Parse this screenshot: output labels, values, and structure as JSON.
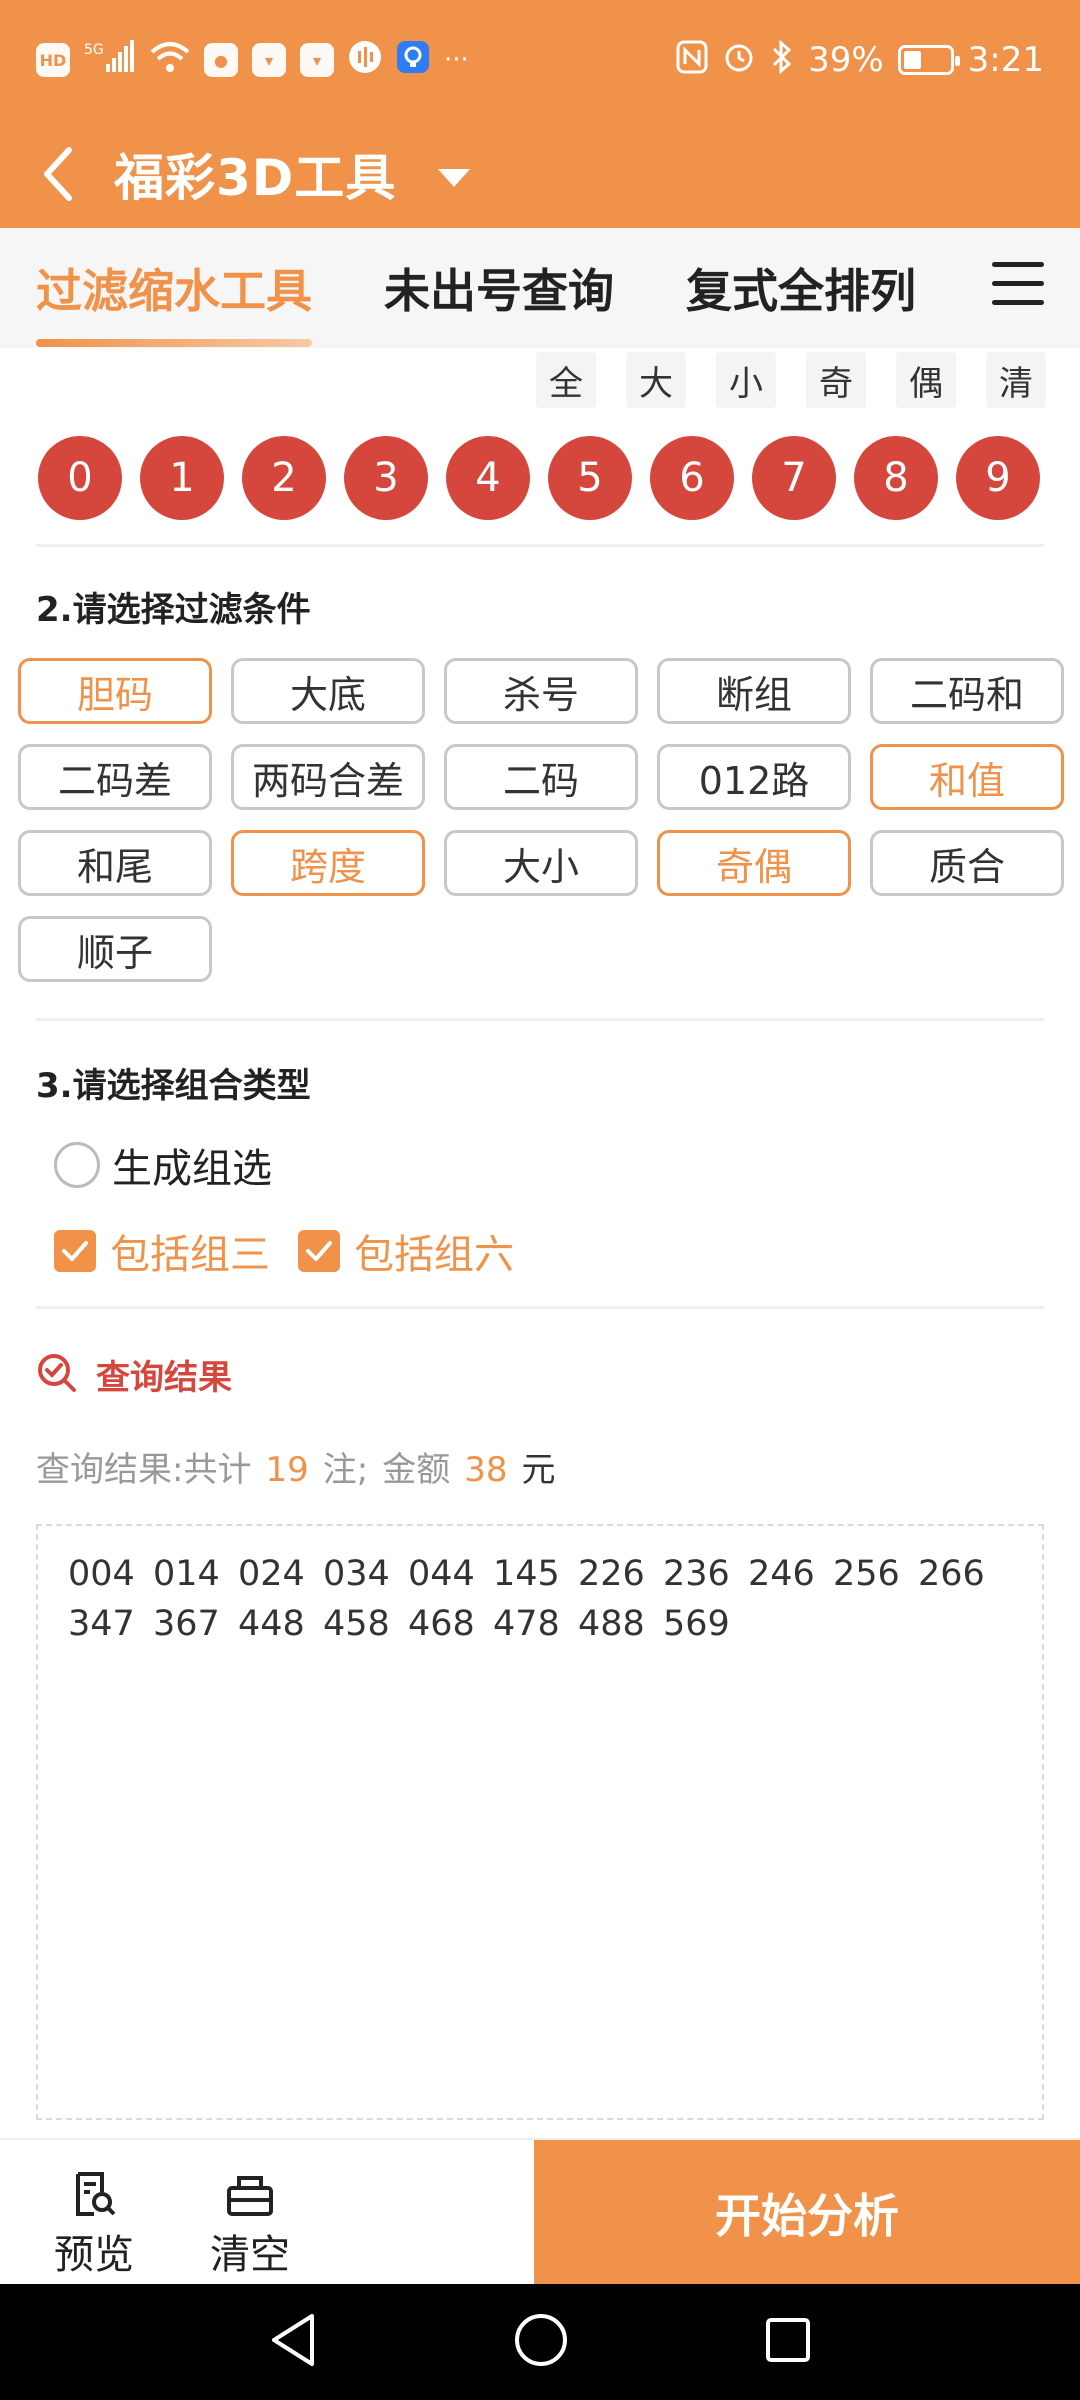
{
  "status_bar": {
    "left_icons": [
      "hd-icon",
      "signal-5g-icon",
      "wifi-icon",
      "weibo-icon",
      "bag-icon",
      "bag-icon",
      "voice-icon",
      "bulb-icon",
      "more-icon"
    ],
    "hd": "HD",
    "network": "5G",
    "more": "···",
    "battery_percent": "39%",
    "battery_level": 0.39,
    "time": "3:21"
  },
  "header": {
    "title": "福彩3D工具"
  },
  "tabs": [
    {
      "label": "过滤缩水工具",
      "active": true
    },
    {
      "label": "未出号查询",
      "active": false
    },
    {
      "label": "复式全排列",
      "active": false
    }
  ],
  "quick_filters": [
    "全",
    "大",
    "小",
    "奇",
    "偶",
    "清"
  ],
  "balls": [
    "0",
    "1",
    "2",
    "3",
    "4",
    "5",
    "6",
    "7",
    "8",
    "9"
  ],
  "conditions": {
    "title": "2.请选择过滤条件",
    "items": [
      {
        "label": "胆码",
        "selected": true
      },
      {
        "label": "大底",
        "selected": false
      },
      {
        "label": "杀号",
        "selected": false
      },
      {
        "label": "断组",
        "selected": false
      },
      {
        "label": "二码和",
        "selected": false
      },
      {
        "label": "二码差",
        "selected": false
      },
      {
        "label": "两码合差",
        "selected": false
      },
      {
        "label": "二码",
        "selected": false
      },
      {
        "label": "012路",
        "selected": false
      },
      {
        "label": "和值",
        "selected": true
      },
      {
        "label": "和尾",
        "selected": false
      },
      {
        "label": "跨度",
        "selected": true
      },
      {
        "label": "大小",
        "selected": false
      },
      {
        "label": "奇偶",
        "selected": true
      },
      {
        "label": "质合",
        "selected": false
      },
      {
        "label": "顺子",
        "selected": false
      }
    ]
  },
  "combo": {
    "title": "3.请选择组合类型",
    "radio_label": "生成组选",
    "check_group3": "包括组三",
    "check_group6": "包括组六"
  },
  "result": {
    "label": "查询结果",
    "summary_prefix": "查询结果:共计",
    "count": "19",
    "mid": "注;",
    "amount_label": "金额",
    "amount": "38",
    "unit": "元",
    "numbers": [
      "004",
      "014",
      "024",
      "034",
      "044",
      "145",
      "226",
      "236",
      "246",
      "256",
      "266",
      "347",
      "367",
      "448",
      "458",
      "468",
      "478",
      "488",
      "569"
    ]
  },
  "bottom_bar": {
    "preview": "预览",
    "clear": "清空",
    "start": "开始分析"
  },
  "colors": {
    "accent": "#F0924A",
    "ball": "#D5473D",
    "result_red": "#D5473D"
  }
}
